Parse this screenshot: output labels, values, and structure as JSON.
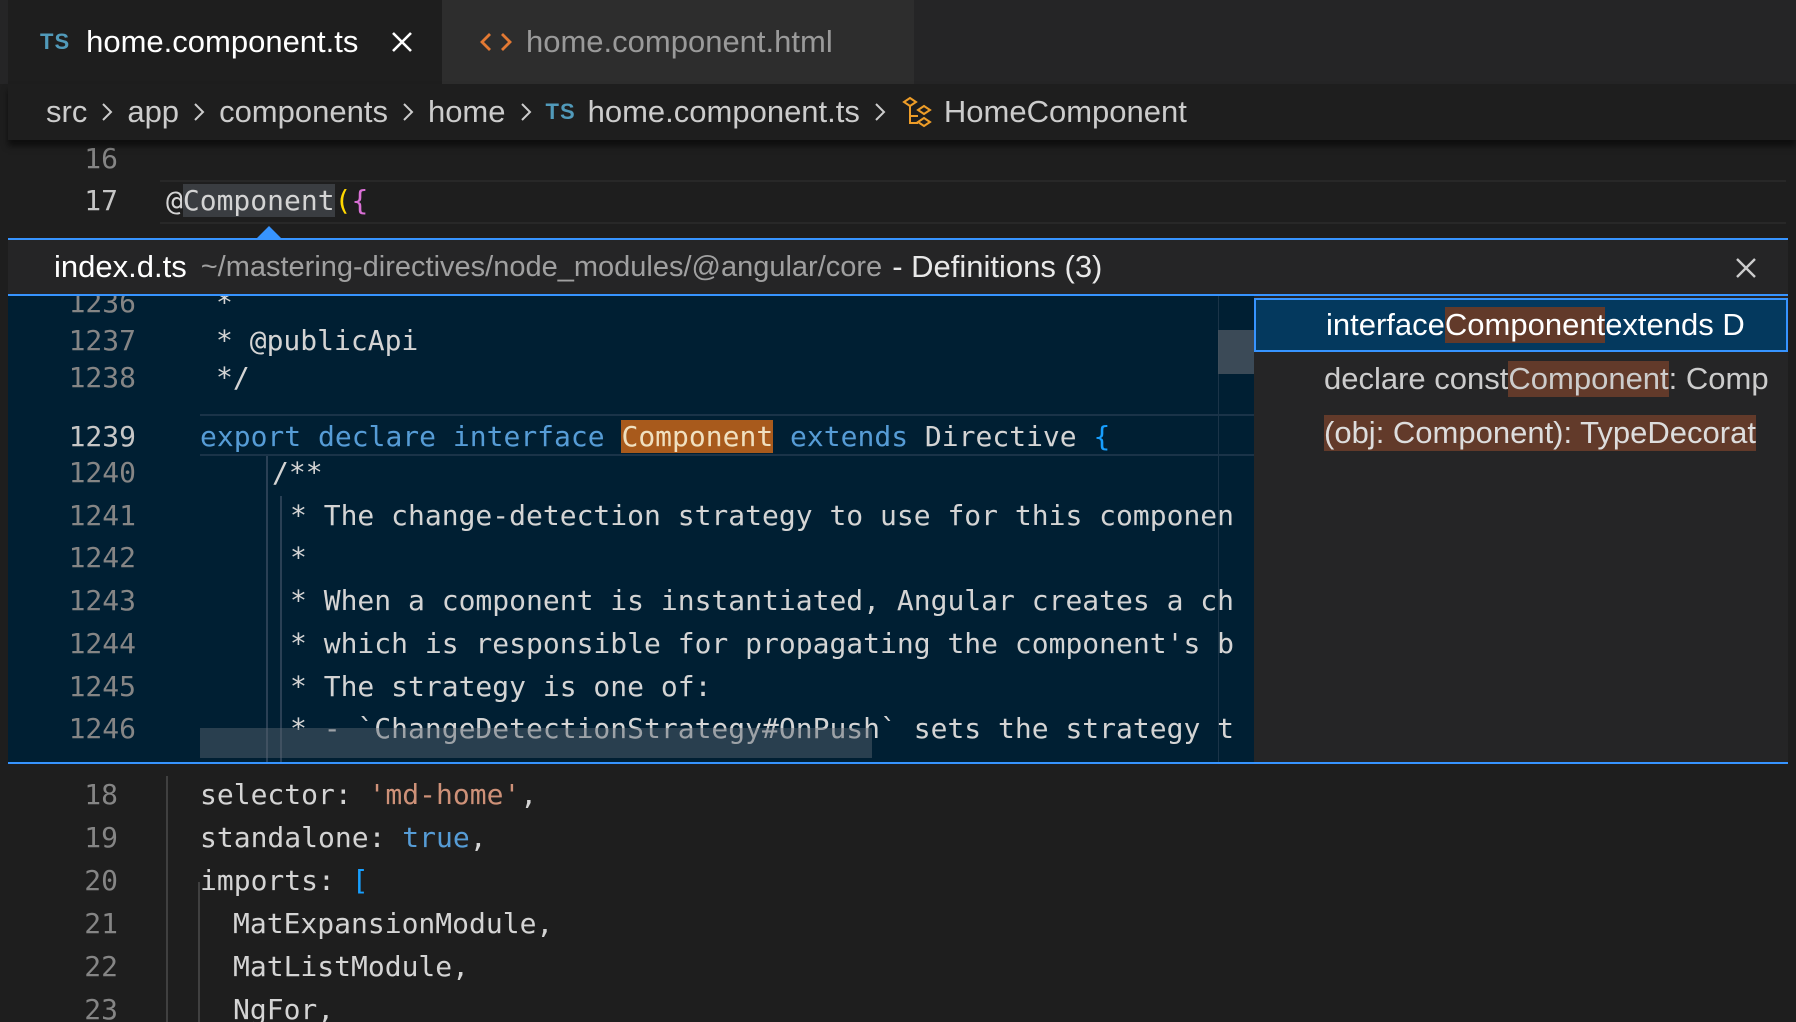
{
  "tabs": [
    {
      "badge": "TS",
      "label": "home.component.ts",
      "active": true
    },
    {
      "badge": "<>",
      "label": "home.component.html",
      "active": false
    }
  ],
  "breadcrumb": {
    "items": [
      "src",
      "app",
      "components",
      "home"
    ],
    "file_badge": "TS",
    "file": "home.component.ts",
    "symbol": "HomeComponent"
  },
  "editor": {
    "top_lines": [
      {
        "num": "16",
        "text": ""
      },
      {
        "num": "17",
        "decorator": "@",
        "word": "Component",
        "open": "(",
        "brace": "{"
      }
    ],
    "bottom_lines": [
      {
        "num": "18",
        "key": "selector: ",
        "value": "'md-home'",
        "tail": ","
      },
      {
        "num": "19",
        "key": "standalone: ",
        "value": "true",
        "tail": ","
      },
      {
        "num": "20",
        "key": "imports: ",
        "value": "[",
        "tail": ""
      },
      {
        "num": "21",
        "text": "MatExpansionModule,"
      },
      {
        "num": "22",
        "text": "MatListModule,"
      },
      {
        "num": "23",
        "text": "NgFor,"
      }
    ]
  },
  "peek": {
    "file": "index.d.ts",
    "path": "~/mastering-directives/node_modules/@angular/core",
    "title": "- Definitions (3)",
    "lines": [
      {
        "num": "1236",
        "text": "*"
      },
      {
        "num": "1237",
        "text": "* @publicApi"
      },
      {
        "num": "1238",
        "text": "*/"
      },
      {
        "num": "1239",
        "kw1": "export",
        "kw2": "declare",
        "kw3": "interface",
        "match": "Component",
        "kw4": "extends",
        "type": "Directive",
        "brace": "{"
      },
      {
        "num": "1240",
        "text": "/**"
      },
      {
        "num": "1241",
        "text": "* The change-detection strategy to use for this componen"
      },
      {
        "num": "1242",
        "text": "*"
      },
      {
        "num": "1243",
        "text": "* When a component is instantiated, Angular creates a ch"
      },
      {
        "num": "1244",
        "text": "* which is responsible for propagating the component's b"
      },
      {
        "num": "1245",
        "text": "* The strategy is one of:"
      },
      {
        "num": "1246",
        "text": "* - `ChangeDetectionStrategy#OnPush` sets the strategy t"
      }
    ],
    "references": [
      {
        "before": "interface ",
        "match": "Component",
        "after": " extends D"
      },
      {
        "before": "declare const ",
        "match": "Component",
        "after": ": Comp"
      },
      {
        "before": "(obj: Component): TypeDecorat",
        "match": "",
        "after": ""
      }
    ]
  },
  "colors": {
    "peek_border": "#3794ff",
    "peek_background": "#001f33",
    "match_highlight": "#a85a1c",
    "comment": "#6a9955",
    "keyword": "#569cd6"
  }
}
